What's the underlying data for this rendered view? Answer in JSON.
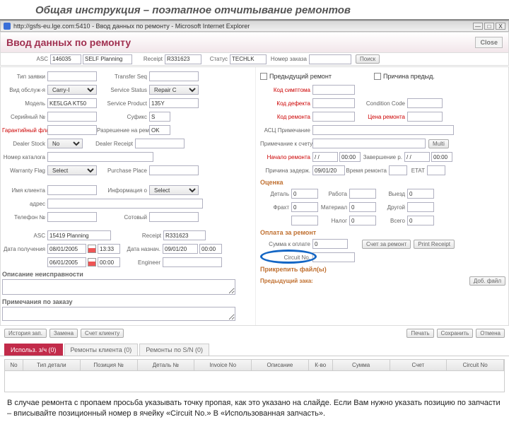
{
  "slide": {
    "title": "Общая инструкция – поэтапное отчитывание ремонтов"
  },
  "ie": {
    "url_title": "http://gsfs-eu.lge.com:5410 - Ввод данных по ремонту - Microsoft Internet Explorer",
    "min": "—",
    "max": "□",
    "close": "X"
  },
  "header": {
    "title": "Ввод данных по ремонту",
    "btn_close": "Close"
  },
  "top": {
    "asc_lbl": "ASC",
    "asc_val": "146035",
    "asc_name": "SELF Planning",
    "receipt_lbl": "Receipt",
    "receipt_val": "R331623",
    "status_lbl": "Статус",
    "status_val": "TECHLK",
    "orderno_lbl": "Номер заказа",
    "orderno_val": "",
    "search_btn": "Поиск"
  },
  "left": {
    "r1": {
      "l1": "Тип заявки",
      "v1": "",
      "l2": "Transfer Seq",
      "v2": ""
    },
    "r2": {
      "l1": "Вид обслуж-я",
      "v1": "Carry-I",
      "l2": "Service Status",
      "v2": "Repair C"
    },
    "r3": {
      "l1": "Модель",
      "v1": "KE5LGA KT50",
      "l2": "Service Product",
      "v2": "135Y"
    },
    "r4": {
      "l1": "Серийный №",
      "v1": "",
      "l2": "Cуфикс",
      "v2": "S"
    },
    "r5": {
      "l1": "Гарантийный флаг",
      "v1": "",
      "l2": "Разрешение на ремонт",
      "v2": "OK"
    },
    "r6": {
      "l1": "Dealer Stock",
      "v1": "No",
      "l2": "Dealer Receipt",
      "v2": ""
    },
    "r7": {
      "l1": "Номер каталога",
      "v1": ""
    },
    "r8": {
      "l1": "Warranty Flag",
      "v1": "Select",
      "l2": "Purchase Place",
      "v2": ""
    },
    "r9": {
      "l1": "Имя клиента",
      "v1": "",
      "l2": "Информация о",
      "v2": "Select"
    },
    "r10": {
      "l1": "адрес",
      "v1": ""
    },
    "r11": {
      "l1": "Телефон №",
      "v1": "",
      "l2": "Сотовый",
      "v2": ""
    },
    "asc2_lbl": "ASC",
    "asc2_val": "15419 Planning",
    "rcpt2_lbl": "Receipt",
    "rcpt2_val": "R331623",
    "date1_lbl": "Дата получения",
    "date1_d": "08/01/2005",
    "date1_t": "13:33",
    "date2_lbl": "Дата назнач.",
    "date2_d": "09/01/20",
    "date2_t": "00:00",
    "date3_d": "06/01/2005",
    "date3_t": "00:00",
    "lbl_eng": "Engineer",
    "eng_val": "",
    "sec1": "Описание неисправности",
    "sec2": "Примечания по заказу",
    "btns": {
      "b1": "История зап.",
      "b2": "Замена",
      "b3": "Счет клиенту",
      "b4": "Печать",
      "b5": "Сохранить",
      "b6": "Отмена"
    }
  },
  "right": {
    "chk1": "Предыдущий ремонт",
    "chk2": "Причина предыд.",
    "r1": {
      "l": "Код симптома",
      "v": ""
    },
    "r2": {
      "l": "Код дефекта",
      "v": "",
      "l2": "Condition Code",
      "v2": ""
    },
    "r3": {
      "l": "Код ремонта",
      "v": "",
      "l2": "Цена ремонта",
      "v2": ""
    },
    "r4": {
      "l": "АСЦ Примечание",
      "v": ""
    },
    "r5": {
      "l": "Примечание к счету",
      "v": "",
      "btn": "Multi"
    },
    "r6": {
      "l": "Начало ремонта",
      "d": "/ /",
      "t": "00:00",
      "l2": "Завершение р.",
      "d2": "/ /",
      "t2": "00:00"
    },
    "r7": {
      "l": "Причина задерж.",
      "d": "09/01/20",
      "l2": "Время ремонта",
      "v2": "",
      "l3": "ETAT",
      "v3": ""
    },
    "sec_est": "Оценка",
    "est": {
      "l1": "Деталь",
      "v1": "0",
      "l2": "Работа",
      "v2": "",
      "l3": "Выезд",
      "v3": "0",
      "l4": "Фрахт",
      "v4": "0",
      "l5": "Материал",
      "v5": "0",
      "l6": "Другой",
      "v6": "",
      "l7": "",
      "v7": "",
      "l8": "Налог",
      "v8": "0",
      "l9": "Всего",
      "v9": "0"
    },
    "sec_pay": "Оплата за ремонт",
    "pay": {
      "l": "Сумма к оплате",
      "v": "0",
      "b1": "Счет за ремонт",
      "b2": "Print Receipt"
    },
    "circ_lbl": "Circuit No.",
    "circ_val": "",
    "sec_att": "Прикрепить файл(ы)",
    "sec_prev": "Предыдущий заказ",
    "prev_btn": "Доб. файл"
  },
  "tabs": {
    "t1": "Использ. з/ч (0)",
    "t2": "Ремонты клиента (0)",
    "t3": "Ремонты по S/N (0)"
  },
  "grid": {
    "c1": "No",
    "c2": "Тип детали",
    "c3": "Позиция №",
    "c4": "Деталь №",
    "c5": "Invoice No",
    "c6": "Описание",
    "c7": "К-во",
    "c8": "Сумма",
    "c9": "Счет",
    "c10": "Circuit No"
  },
  "foot": "В случае ремонта с пропаем просьба указывать точку пропая, как это указано на слайде. Если Вам нужно указать позицию по запчасти – вписывайте позиционный номер в ячейку «Circuit No.» В «Использованная запчасть»."
}
